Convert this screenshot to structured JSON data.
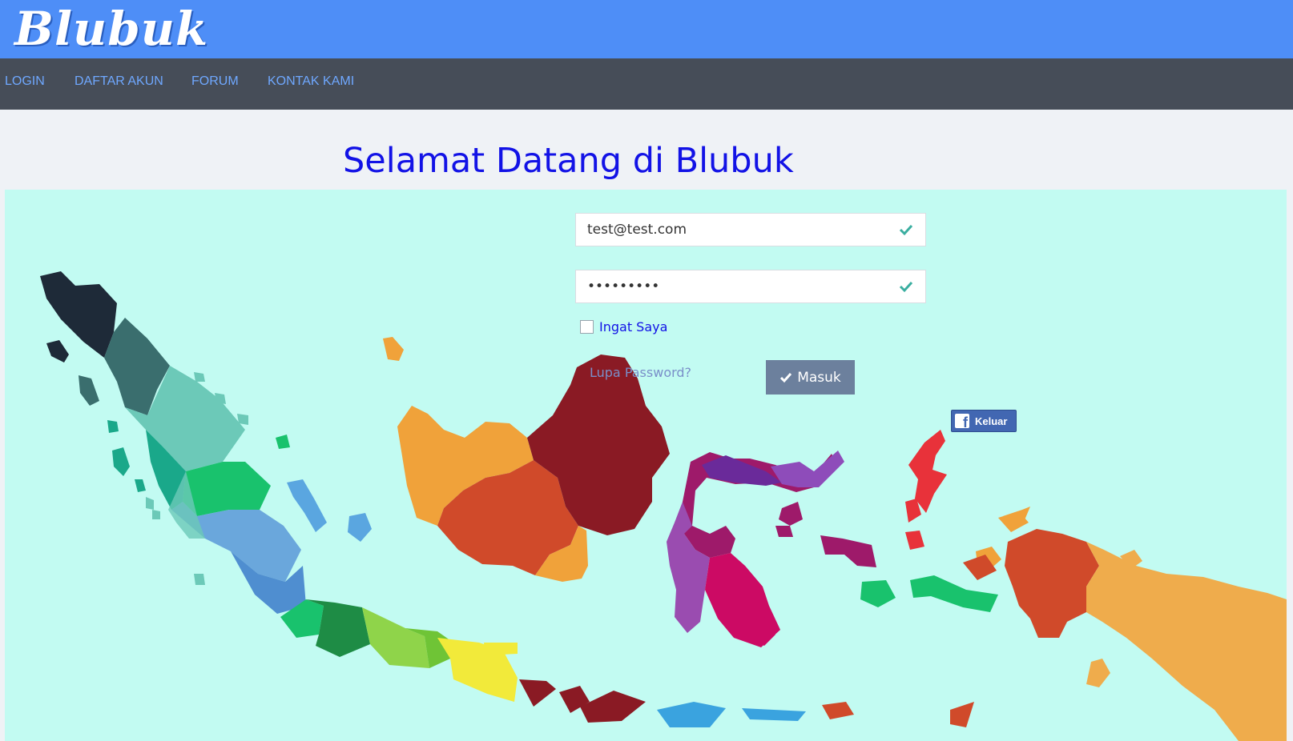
{
  "header": {
    "logo_text": "Blubuk"
  },
  "nav": {
    "items": [
      {
        "label": "LOGIN"
      },
      {
        "label": "DAFTAR AKUN"
      },
      {
        "label": "FORUM"
      },
      {
        "label": "KONTAK KAMI"
      }
    ]
  },
  "main": {
    "title": "Selamat Datang di Blubuk"
  },
  "login_form": {
    "email_value": "test@test.com",
    "password_value": "•••••••••",
    "remember_label": "Ingat Saya",
    "forgot_label": "Lupa Password?",
    "submit_label": "Masuk",
    "facebook_label": "Keluar"
  },
  "colors": {
    "header_bg": "#4e8ef7",
    "nav_bg": "#464d58",
    "nav_text": "#6fa8ff",
    "title": "#1212e6",
    "map_bg": "#c2fbf2",
    "button": "#6c809d",
    "facebook": "#4267b2",
    "valid_check": "#3aaea0"
  },
  "icons": [
    "check-icon",
    "facebook-icon"
  ]
}
